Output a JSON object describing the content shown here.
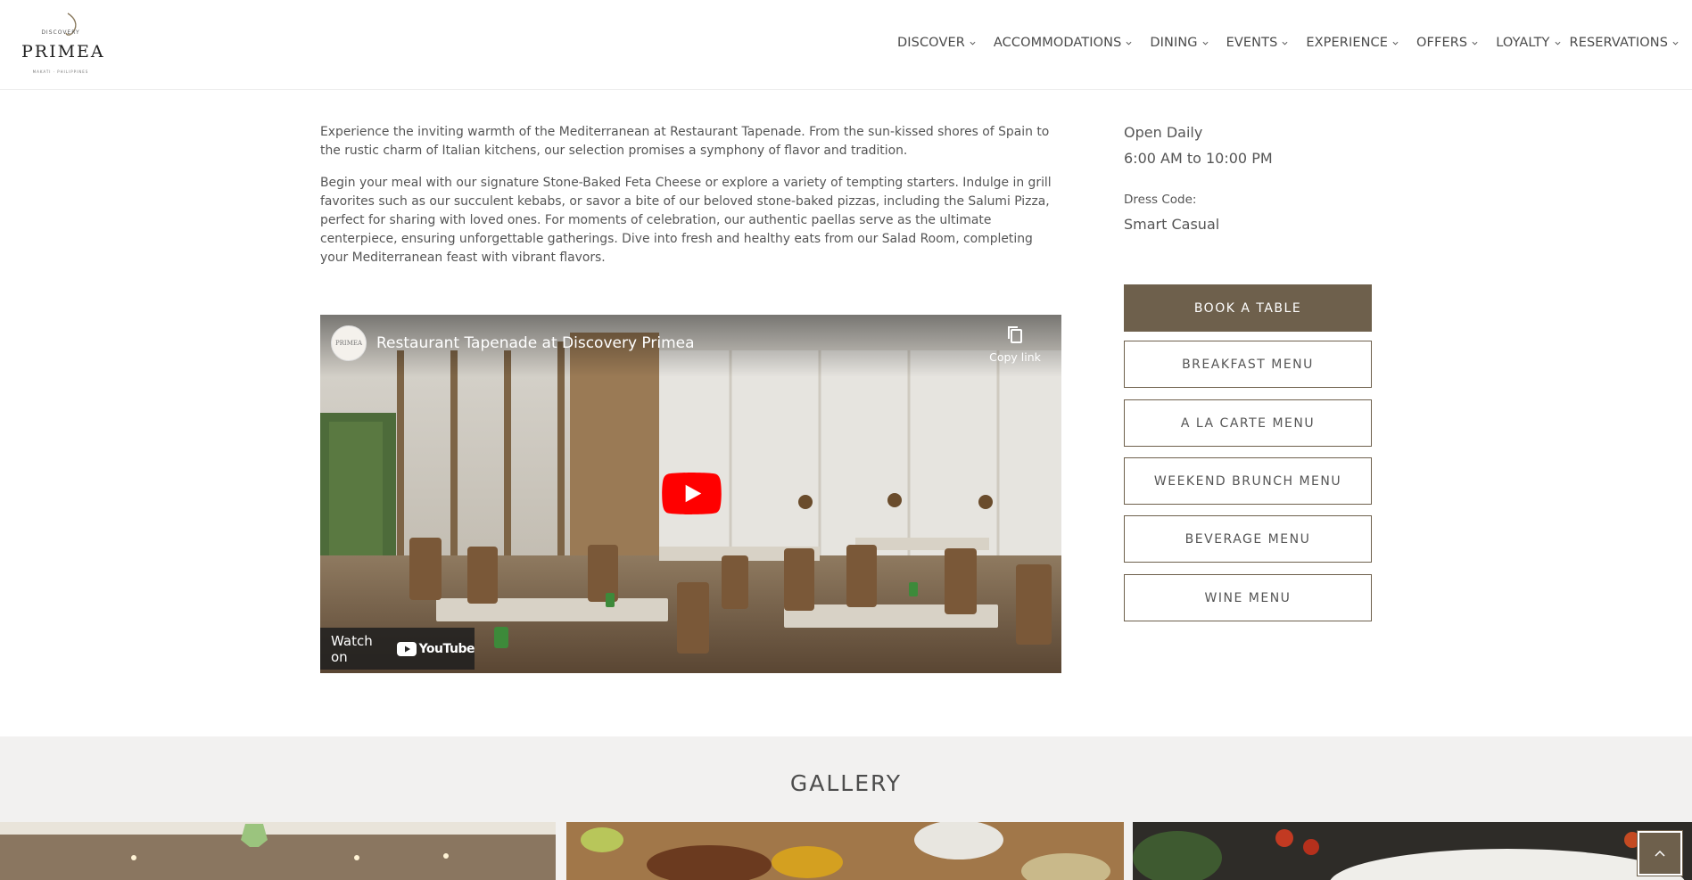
{
  "logo": {
    "top_word": "DISCOVERY",
    "brand": "PRIMEA",
    "tagline": "MAKATI · PHILIPPINES"
  },
  "nav": {
    "items": [
      {
        "label": "DISCOVER"
      },
      {
        "label": "ACCOMMODATIONS"
      },
      {
        "label": "DINING"
      },
      {
        "label": "EVENTS"
      },
      {
        "label": "EXPERIENCE"
      },
      {
        "label": "OFFERS"
      },
      {
        "label": "LOYALTY"
      },
      {
        "label": "RESERVATIONS"
      }
    ]
  },
  "intro": {
    "p1": "Experience the inviting warmth of the Mediterranean at Restaurant Tapenade. From the sun-kissed shores of Spain to the rustic charm of Italian kitchens, our selection promises a symphony of flavor and tradition.",
    "p2": "Begin your meal with our signature Stone-Baked Feta Cheese or explore a variety of tempting starters. Indulge in grill favorites such as our succulent kebabs, or savor a bite of our beloved stone-baked pizzas, including the Salumi Pizza, perfect for sharing with loved ones. For moments of celebration, our authentic paellas serve as the ultimate centerpiece, ensuring unforgettable gatherings. Dive into fresh and healthy eats from our Salad Room, completing your Mediterranean feast with vibrant flavors."
  },
  "video": {
    "title": "Restaurant Tapenade at Discovery Primea",
    "copy_link": "Copy link",
    "watch_on": "Watch on",
    "youtube": "YouTube",
    "channel_avatar": "PRIMEA"
  },
  "info": {
    "open_label": "Open Daily",
    "hours": "6:00 AM to 10:00 PM",
    "dress_label": "Dress Code:",
    "dress_value": "Smart Casual"
  },
  "buttons": {
    "book": "BOOK A TABLE",
    "breakfast": "BREAKFAST MENU",
    "alacarte": "A LA CARTE MENU",
    "brunch": "WEEKEND BRUNCH MENU",
    "beverage": "BEVERAGE MENU",
    "wine": "WINE MENU"
  },
  "gallery": {
    "title": "GALLERY"
  },
  "colors": {
    "brand": "#6e604c",
    "youtube_red": "#ff0000"
  },
  "icons": [
    "chevron-down-icon",
    "copy-icon",
    "play-icon",
    "youtube-logo-icon",
    "back-to-top-icon"
  ]
}
